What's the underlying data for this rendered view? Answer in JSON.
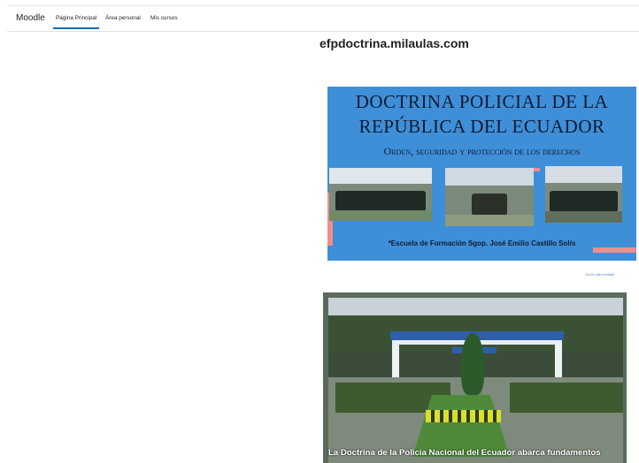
{
  "navbar": {
    "brand": "Moodle",
    "items": [
      {
        "label": "Página Principal",
        "active": true
      },
      {
        "label": "Área personal",
        "active": false
      },
      {
        "label": "Mis cursos",
        "active": false
      }
    ]
  },
  "site": {
    "title": "efpdoctrina.milaulas.com"
  },
  "banner1": {
    "title_line1": "DOCTRINA POLICIAL DE LA",
    "title_line2": "REPÚBLICA DEL ECUADOR",
    "subtitle": "Orden, seguridad y protección de los derechos",
    "caption": "*Escuela de Formación Sgop. José Emilio Castillo Solís",
    "background_color": "#3f8fd8",
    "accent_color": "#f08d8d"
  },
  "credit": {
    "prefix": "Diseñe",
    "link": "with a imitate"
  },
  "banner2": {
    "caption": "La Doctrina de la Policía Nacional del Ecuador abarca fundamentos"
  }
}
